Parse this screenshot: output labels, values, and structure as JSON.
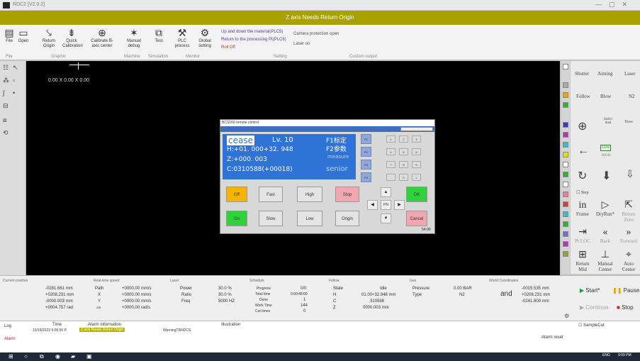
{
  "window": {
    "title": "RDC2 [V2.0.2]",
    "alert": "Z axis Needs Return Origin"
  },
  "ribbon": {
    "buttons": [
      {
        "icon": "file-icon",
        "label": "File"
      },
      {
        "icon": "open-icon",
        "label": "Open"
      },
      {
        "icon": "return-origin-icon",
        "label": "Return Origin"
      },
      {
        "icon": "quick-calibration-icon",
        "label": "Quick Calibration"
      },
      {
        "icon": "calibrate-center-icon",
        "label": "Calibrate B-axis center"
      },
      {
        "icon": "manual-debug-icon",
        "label": "Manual debug"
      },
      {
        "icon": "test-icon",
        "label": "Test"
      },
      {
        "icon": "plc-icon",
        "label": "PLC process"
      },
      {
        "icon": "global-setting-icon",
        "label": "Global setting"
      }
    ],
    "groups": [
      "File",
      "Graphic",
      "Machine",
      "Simulation",
      "Monitor",
      "Setting",
      "Custom output"
    ],
    "options": [
      "Up and down the material(PLC5)",
      "Return to the processing Pt(PLC8)",
      "Roll Off",
      "Camera protection open",
      "Laser on"
    ]
  },
  "canvas": {
    "coord": "0.00 X 0.00 X 0.00"
  },
  "remote": {
    "title": "BCS100 remote control",
    "lcd": {
      "line1": "cease",
      "level": "Lv. 10",
      "line2": "H:+01. 000+32. 948",
      "line3": "Z:+000. 003",
      "line4": "C:0310588(+00018)",
      "tag1": "F1标定",
      "tag2": "F2参数",
      "tag3": "measure",
      "tag4": "senior"
    },
    "fkeys": [
      "F1",
      "F2",
      "F3",
      "F4"
    ],
    "keypad": [
      "1",
      "2",
      "3",
      "4",
      "5",
      "6",
      "7",
      "8",
      "9",
      ".",
      "0",
      "<"
    ],
    "buttons": {
      "off": "Off",
      "fast": "Fast",
      "high": "High",
      "stop": "Stop",
      "ok": "OK",
      "on": "On",
      "slow": "Slow",
      "low": "Low",
      "origin": "Origin",
      "cancel": "Cancel",
      "fn": "FN"
    },
    "version": "54.00"
  },
  "right": {
    "top": [
      {
        "label": "Shutter"
      },
      {
        "label": "Aiming"
      },
      {
        "label": "Laser"
      },
      {
        "label": "Follow"
      },
      {
        "label": "Blow"
      },
      {
        "label": "N2"
      }
    ],
    "mid": [
      {
        "label": "Indivi dual"
      },
      {
        "label": "Three"
      },
      {
        "label": "LOW"
      },
      {
        "label": "HIGH"
      }
    ],
    "step": "Step",
    "moves": [
      {
        "icon": "in-icon",
        "label": "Frame"
      },
      {
        "icon": "play-icon",
        "label": "DryRun*"
      },
      {
        "icon": "zero-icon",
        "label": "Return Zero"
      },
      {
        "icon": "pt-loc-icon",
        "label": "Pt LOC"
      },
      {
        "icon": "back-icon",
        "label": "Back"
      },
      {
        "icon": "forward-icon",
        "label": "Forward"
      },
      {
        "icon": "return-mid-icon",
        "label": "Return Mid"
      },
      {
        "icon": "manual-center-icon",
        "label": "Manual Center"
      },
      {
        "icon": "auto-center-icon",
        "label": "Auto Center"
      }
    ],
    "start": "Start*",
    "pause": "Pause",
    "continue": "Continue",
    "stop": "Stop",
    "samplecut": "SampleCut"
  },
  "status": {
    "current": {
      "title": "Current position",
      "v": [
        "-0281.661 mm",
        "+0208.231 mm",
        "-0000.003 mm",
        "+0004.757 rad"
      ]
    },
    "speed": {
      "title": "Real-time speed",
      "keys": [
        "Path",
        "X",
        "Y",
        "Z/B"
      ],
      "v": [
        "+0000.00 mm/s",
        "+0000.00 mm/s",
        "+0000.00 mm/s",
        "+0000.00 rad/s"
      ]
    },
    "laser": {
      "title": "Laser",
      "keys": [
        "Power",
        "Ratio",
        "Freq"
      ],
      "v": [
        "30.0 %",
        "30.0 %",
        "5000 HZ"
      ]
    },
    "schedule": {
      "title": "Schedule",
      "keys": [
        "Progress",
        "Total time",
        "Done",
        "Work Time",
        "Cut times"
      ],
      "v": [
        "0/0",
        "0:00:48:09",
        "1",
        "144",
        "0"
      ]
    },
    "follow": {
      "title": "Follow",
      "keys": [
        "State",
        "H",
        "C",
        "Z"
      ],
      "v": [
        "Idle",
        "01.00+32.948 mm",
        "310588",
        "0000.003 mm"
      ]
    },
    "gas": {
      "title": "Gas",
      "keys": [
        "Pressure",
        "Type"
      ],
      "v": [
        "0.00 BAR",
        "N2"
      ]
    },
    "world": {
      "title": "World Coordinates",
      "and": "and",
      "v": [
        "-0015.535 mm",
        "+0208.231 mm",
        "-0241.809 mm"
      ]
    }
  },
  "log": {
    "headers": [
      "Log",
      "Time",
      "Alarm information",
      "Illustration"
    ],
    "alarm_label": "Alarm",
    "row_time": "10/18/2023 9:06:50 P",
    "row_alarm": "Z axis Needs Return Origin",
    "row_code": "WarningTRNDCS",
    "reset": "Alarm reset"
  },
  "taskbar": {
    "lang": "ENG",
    "time": "9:09 PM"
  }
}
